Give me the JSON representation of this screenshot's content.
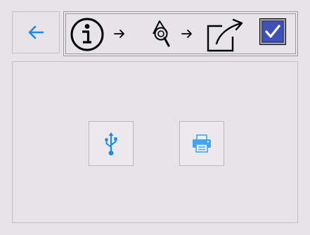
{
  "header": {
    "back_button": {
      "icon": "arrow-left-icon",
      "color": "#1e88e5"
    },
    "wizard_steps": [
      {
        "icon": "info-circle-icon",
        "state": "done"
      },
      {
        "icon": "arrow-right-icon",
        "state": "separator"
      },
      {
        "icon": "shapes-search-icon",
        "state": "done"
      },
      {
        "icon": "arrow-right-icon",
        "state": "separator"
      },
      {
        "icon": "export-share-icon",
        "state": "done"
      },
      {
        "icon": "checkbox-checked-icon",
        "state": "current",
        "checked": true
      }
    ]
  },
  "main": {
    "actions": [
      {
        "id": "usb",
        "icon": "usb-icon",
        "color": "#1e88e5"
      },
      {
        "id": "print",
        "icon": "printer-icon",
        "color": "#42a5f5"
      }
    ]
  },
  "colors": {
    "background": "#e6e4e8",
    "accent": "#1e88e5",
    "checkbox_fill": "#3f51b5"
  }
}
